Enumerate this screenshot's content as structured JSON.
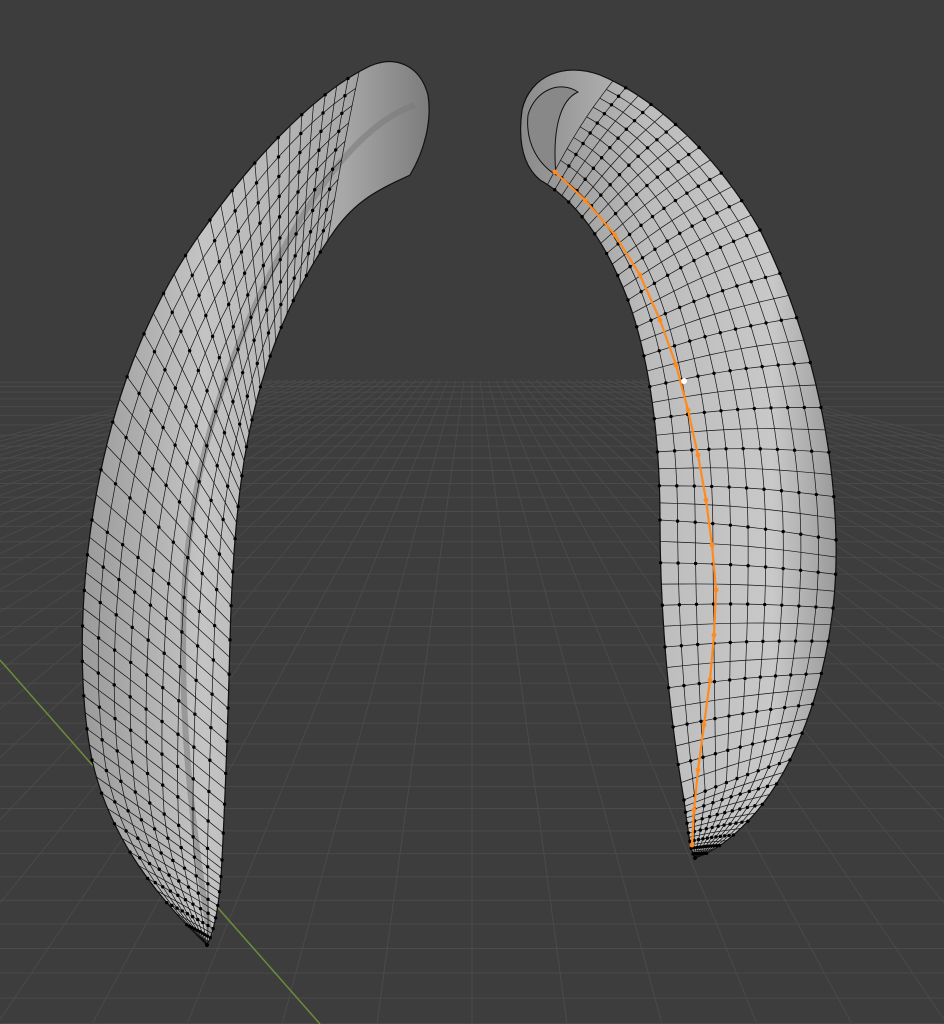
{
  "app": {
    "mode": "edit-mode",
    "view": "perspective-viewport"
  },
  "colors": {
    "background": "#3d3d3d",
    "grid": "#4a4a4a",
    "axis_y": "#6c8c3a",
    "mesh_fill": "#b3b3b3",
    "mesh_shadow": "#8f8f8f",
    "wire": "#111111",
    "vertex": "#000000",
    "selected": "#ff8a1f",
    "active_vertex": "#ffffff"
  },
  "objects": [
    {
      "name": "horn-left",
      "selected": false
    },
    {
      "name": "horn-right",
      "selected": true,
      "selection": "edge-loop"
    }
  ]
}
